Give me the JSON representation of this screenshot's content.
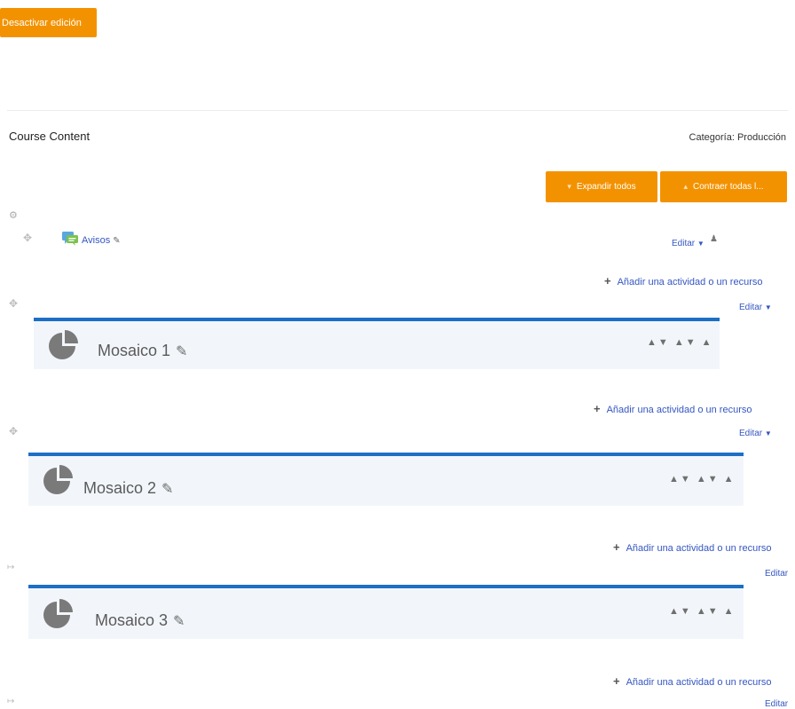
{
  "header": {
    "toggle_edit_label": "Desactivar edición"
  },
  "course": {
    "title": "Course Content",
    "category": "Categoría: Producción"
  },
  "controls": {
    "expand_all": "Expandir todos",
    "collapse_all": "Contraer todas l..."
  },
  "avisos": {
    "label": "Avisos",
    "edit": "Editar"
  },
  "add_activity_label": "Añadir una actividad o un recurso",
  "edit_label": "Editar",
  "tiles": [
    {
      "name": "Mosaico 1"
    },
    {
      "name": "Mosaico 2"
    },
    {
      "name": "Mosaico 3"
    }
  ],
  "colors": {
    "accent": "#f39200",
    "tile_border": "#1c6fc6",
    "link": "#3556c2",
    "tile_bg": "#f2f6fb"
  },
  "icons": [
    "gear-icon",
    "move-icon",
    "forum-icon",
    "pencil-icon",
    "user-icon",
    "pie-chart-icon",
    "plus-icon",
    "caret-down-icon"
  ]
}
